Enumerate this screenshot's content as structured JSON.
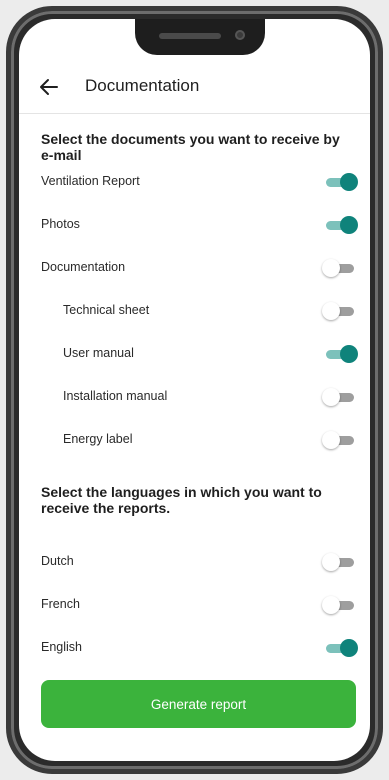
{
  "header": {
    "title": "Documentation"
  },
  "documents": {
    "heading": "Select the documents you want to receive by e-mail",
    "items": [
      {
        "label": "Ventilation Report",
        "on": true,
        "indent": false
      },
      {
        "label": "Photos",
        "on": true,
        "indent": false
      },
      {
        "label": "Documentation",
        "on": false,
        "indent": false
      },
      {
        "label": "Technical sheet",
        "on": false,
        "indent": true
      },
      {
        "label": "User manual",
        "on": true,
        "indent": true
      },
      {
        "label": "Installation manual",
        "on": false,
        "indent": true
      },
      {
        "label": "Energy label",
        "on": false,
        "indent": true
      }
    ]
  },
  "languages": {
    "heading": "Select the languages in which you want to receive the reports.",
    "items": [
      {
        "label": "Dutch",
        "on": false
      },
      {
        "label": "French",
        "on": false
      },
      {
        "label": "English",
        "on": true
      }
    ]
  },
  "actions": {
    "generate_label": "Generate report"
  },
  "colors": {
    "accent_teal": "#0f837b",
    "accent_teal_track": "#7cc1bb",
    "button_green": "#3bb33c",
    "toggle_off": "#9e9e9e"
  }
}
